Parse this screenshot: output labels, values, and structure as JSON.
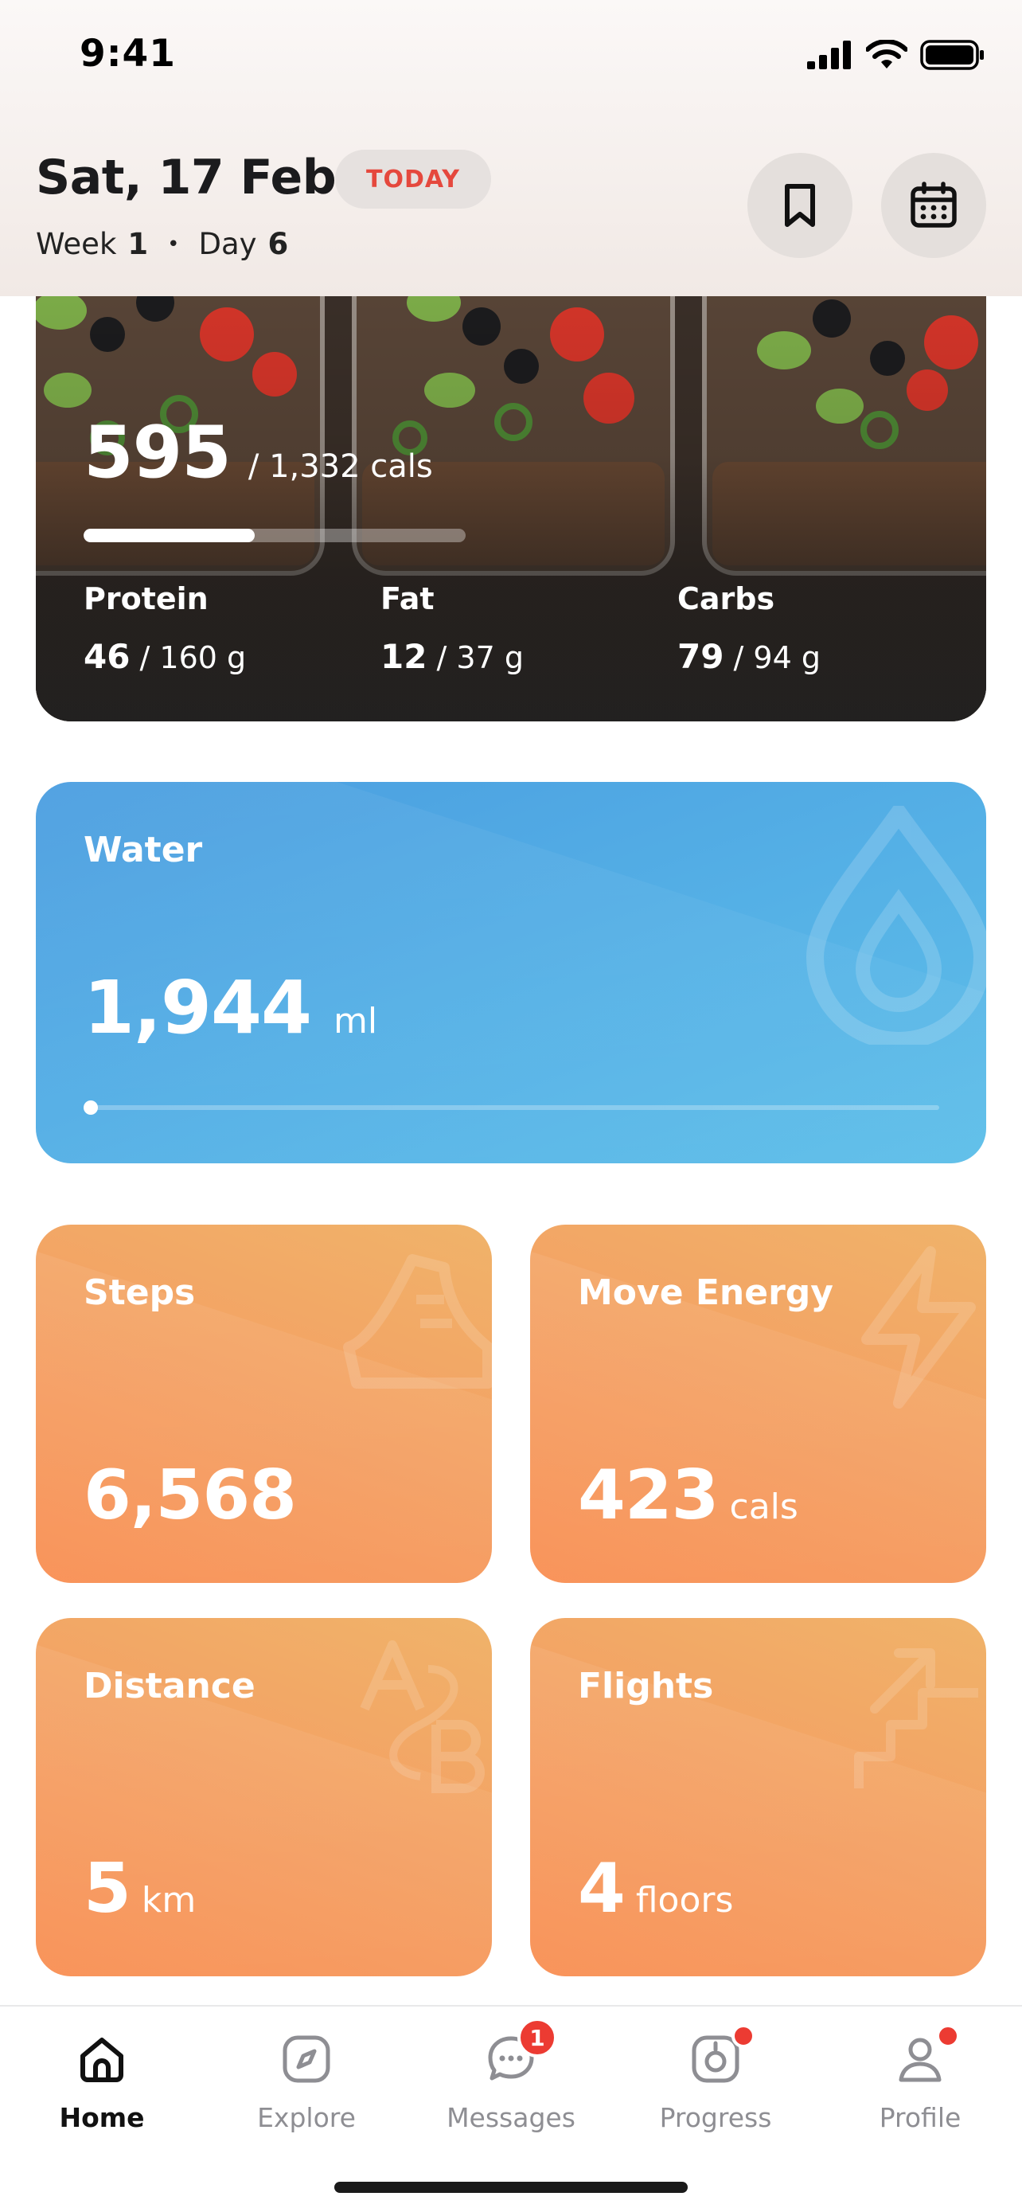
{
  "status_bar": {
    "time": "9:41"
  },
  "header": {
    "date": "Sat, 17 Feb",
    "today_badge": "TODAY",
    "week_label": "Week",
    "week_value": "1",
    "day_label": "Day",
    "day_value": "6",
    "separator": "•"
  },
  "nutrition": {
    "calories_consumed": "595",
    "calories_total": "/ 1,332 cals",
    "calories_progress": 0.447,
    "protein": {
      "label": "Protein",
      "value": "46",
      "target": "/ 160 g"
    },
    "fat": {
      "label": "Fat",
      "value": "12",
      "target": "/ 37 g"
    },
    "carbs": {
      "label": "Carbs",
      "value": "79",
      "target": "/ 94 g"
    }
  },
  "water": {
    "title": "Water",
    "value": "1,944",
    "unit": "ml",
    "progress": 0.0
  },
  "steps": {
    "title": "Steps",
    "value": "6,568",
    "unit": ""
  },
  "move_energy": {
    "title": "Move Energy",
    "value": "423",
    "unit": "cals"
  },
  "distance": {
    "title": "Distance",
    "value": "5",
    "unit": "km"
  },
  "flights": {
    "title": "Flights",
    "value": "4",
    "unit": "floors"
  },
  "tabs": [
    {
      "label": "Home",
      "icon": "home-icon",
      "active": true
    },
    {
      "label": "Explore",
      "icon": "compass-icon",
      "active": false
    },
    {
      "label": "Messages",
      "icon": "chat-bubble-icon",
      "badge": "1",
      "active": false
    },
    {
      "label": "Progress",
      "icon": "progress-icon",
      "active": false
    },
    {
      "label": "Profile",
      "icon": "person-icon",
      "active": false
    }
  ],
  "colors": {
    "accent_red": "#E5483D",
    "water_blue": "#55B1E6",
    "activity_orange": "#F4A063",
    "badge_red": "#EC3B32"
  }
}
